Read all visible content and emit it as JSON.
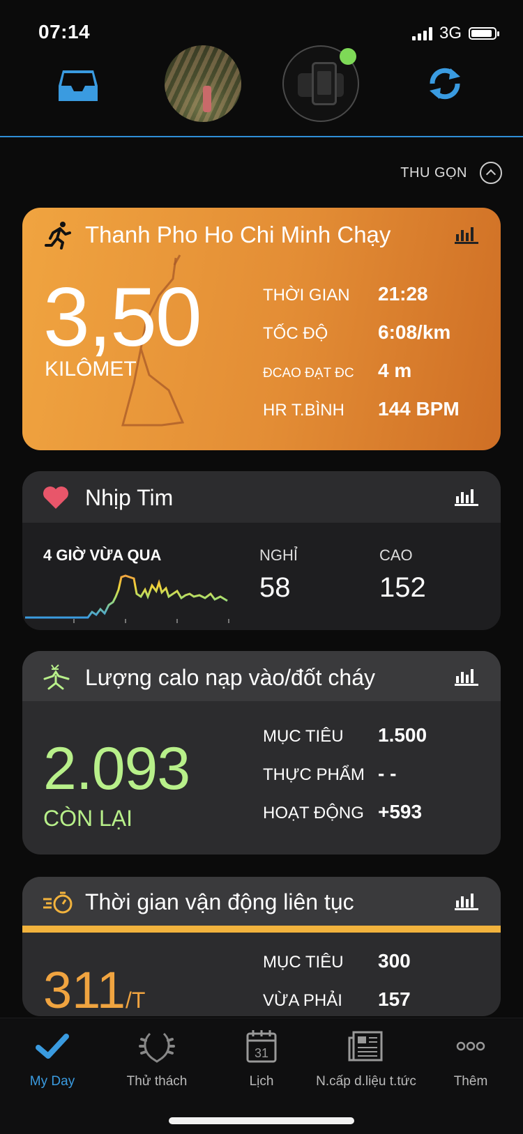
{
  "status_bar": {
    "time": "07:14",
    "network": "3G",
    "battery_level": 0.9
  },
  "collapse": {
    "label": "THU GỌN"
  },
  "run_card": {
    "title": "Thanh Pho Ho Chi Minh Chạy",
    "distance": "3,50",
    "distance_unit": "KILÔMET",
    "stats": [
      {
        "label": "THỜI GIAN",
        "value": "21:28"
      },
      {
        "label": "TỐC ĐỘ",
        "value": "6:08/km"
      },
      {
        "label": "ĐCAO ĐẠT ĐC",
        "value": "4 m"
      },
      {
        "label": "HR T.BÌNH",
        "value": "144 BPM"
      }
    ],
    "accent": "#f0a440"
  },
  "heart_card": {
    "title": "Nhịp Tim",
    "period_label": "4 GIỜ VỪA QUA",
    "rest_label": "NGHỈ",
    "rest_value": "58",
    "high_label": "CAO",
    "high_value": "152",
    "heart_color": "#e8566a"
  },
  "calorie_card": {
    "title": "Lượng calo nạp vào/đốt cháy",
    "remaining_value": "2.093",
    "remaining_label": "CÒN LẠI",
    "stats": [
      {
        "label": "MỤC TIÊU",
        "value": "1.500"
      },
      {
        "label": "THỰC PHẨM",
        "value": "- -"
      },
      {
        "label": "HOẠT ĐỘNG",
        "value": "+593"
      }
    ],
    "accent": "#b8f08a"
  },
  "move_card": {
    "title": "Thời gian vận động liên tục",
    "value": "311",
    "unit": "/T",
    "stats": [
      {
        "label": "MỤC TIÊU",
        "value": "300"
      },
      {
        "label": "VỪA PHẢI",
        "value": "157"
      }
    ],
    "accent": "#f2b33d"
  },
  "tabs": [
    {
      "label": "My Day",
      "icon": "check-icon",
      "active": true
    },
    {
      "label": "Thử thách",
      "icon": "laurel-icon",
      "active": false
    },
    {
      "label": "Lịch",
      "icon": "calendar-icon",
      "active": false,
      "calendar_day": "31"
    },
    {
      "label": "N.cấp d.liệu t.tức",
      "icon": "newsfeed-icon",
      "active": false
    },
    {
      "label": "Thêm",
      "icon": "more-icon",
      "active": false
    }
  ]
}
